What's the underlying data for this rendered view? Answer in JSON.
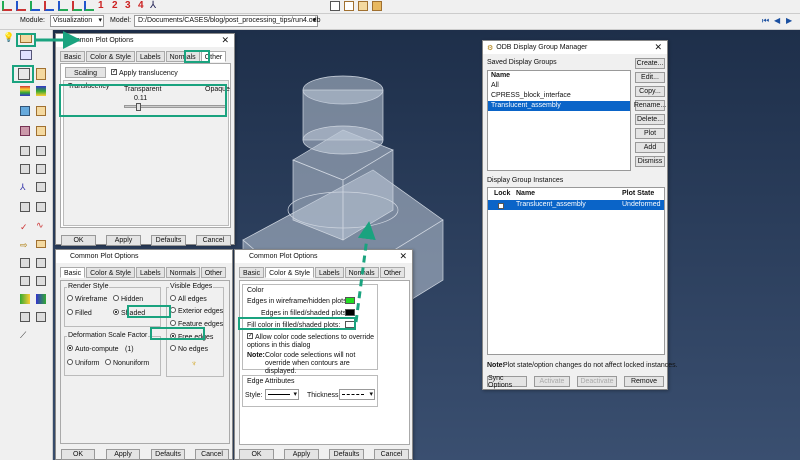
{
  "toolbar": {
    "numbers": [
      "1",
      "2",
      "3",
      "4"
    ],
    "module_label": "Module:",
    "module_value": "Visualization",
    "model_label": "Model:",
    "model_value": "D:/Documents/CASES/blog/post_processing_tips/run4.odb"
  },
  "dlg1": {
    "title": "Common Plot Options",
    "tabs": [
      "Basic",
      "Color & Style",
      "Labels",
      "Normals",
      "Other"
    ],
    "subtab": "Scaling",
    "apply_translucency": "Apply translucency",
    "translucency_label": "Translucency",
    "transparent": "Transparent",
    "opaque": "Opaque",
    "value": "0.11",
    "slider_value": 0.11,
    "buttons": [
      "OK",
      "Apply",
      "Defaults",
      "Cancel"
    ]
  },
  "dlg2": {
    "title": "Common Plot Options",
    "tabs": [
      "Basic",
      "Color & Style",
      "Labels",
      "Normals",
      "Other"
    ],
    "render_style": "Render Style",
    "wireframe": "Wireframe",
    "hidden": "Hidden",
    "filled": "Filled",
    "shaded": "Shaded",
    "def_scale": "Deformation Scale Factor",
    "auto": "Auto-compute",
    "auto_val": "(1)",
    "uniform": "Uniform",
    "nonuniform": "Nonuniform",
    "visible_edges": "Visible Edges",
    "all_edges": "All edges",
    "exterior_edges": "Exterior edges",
    "feature_edges": "Feature edges",
    "free_edges": "Free edges",
    "no_edges": "No edges",
    "buttons": [
      "OK",
      "Apply",
      "Defaults",
      "Cancel"
    ]
  },
  "dlg3": {
    "title": "Common Plot Options",
    "tabs": [
      "Basic",
      "Color & Style",
      "Labels",
      "Normals",
      "Other"
    ],
    "color": "Color",
    "edges_wire": "Edges in wireframe/hidden plots:",
    "edges_filled": "Edges in filled/shaded plots:",
    "fill_color": "Fill color in filled/shaded plots:",
    "allow": "Allow color code selections to override options in this dialog",
    "note_label": "Note:",
    "note": "Color code selections will not override when contours are displayed.",
    "edge_attr": "Edge Attributes",
    "style": "Style:",
    "thickness": "Thickness:",
    "buttons": [
      "OK",
      "Apply",
      "Defaults",
      "Cancel"
    ],
    "colors": {
      "wire": "#22dd22",
      "filled": "#000000",
      "fill": "#ffffff"
    }
  },
  "odb": {
    "title": "ODB Display Group Manager",
    "saved": "Saved Display Groups",
    "name_col": "Name",
    "groups": [
      "All",
      "CPRESS_block_interface",
      "Translucent_assembly"
    ],
    "side_buttons": [
      "Create...",
      "Edit...",
      "Copy...",
      "Rename...",
      "Delete...",
      "Plot",
      "Add",
      "Dismiss"
    ],
    "instances": "Display Group Instances",
    "cols": [
      "Lock",
      "Name",
      "Plot State"
    ],
    "row": {
      "name": "Translucent_assembly",
      "state": "Undeformed"
    },
    "note_label": "Note:",
    "note": "Plot state/option changes do not affect locked instances.",
    "bottom": [
      "Sync Options",
      "Activate",
      "Deactivate",
      "Remove"
    ]
  },
  "colors": {
    "accent": "#1aa37f",
    "select": "#0a64c8",
    "viewport": "#2b3f5c"
  }
}
